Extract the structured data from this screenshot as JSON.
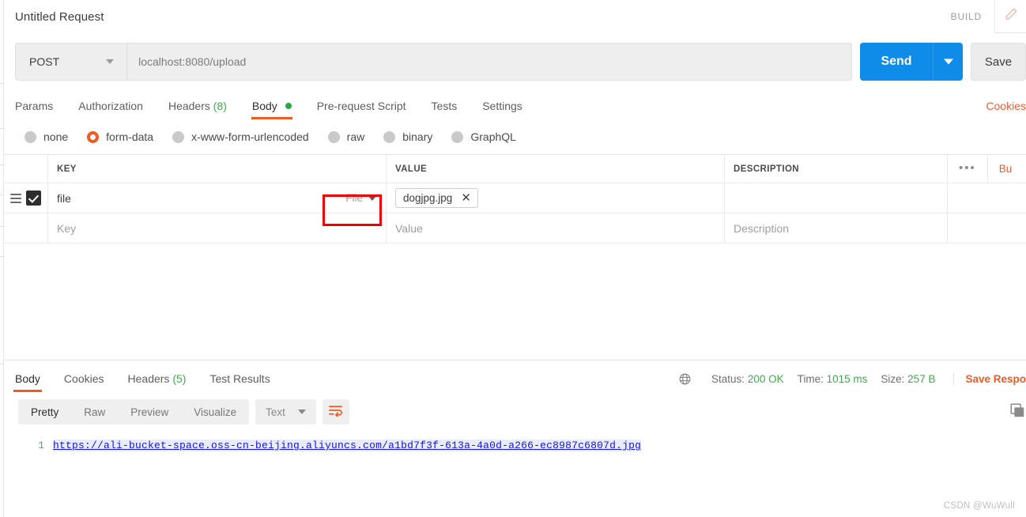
{
  "titlebar": {
    "request_title": "Untitled Request",
    "build_label": "BUILD",
    "edit_icon": "pencil-icon"
  },
  "urlbar": {
    "method": "POST",
    "url": "localhost:8080/upload",
    "send_label": "Send",
    "save_label": "Save"
  },
  "request_tabs": {
    "items": [
      {
        "label": "Params",
        "count": "",
        "active": false
      },
      {
        "label": "Authorization",
        "count": "",
        "active": false
      },
      {
        "label": "Headers",
        "count": "(8)",
        "active": false
      },
      {
        "label": "Body",
        "count": "",
        "active": true
      },
      {
        "label": "Pre-request Script",
        "count": "",
        "active": false
      },
      {
        "label": "Tests",
        "count": "",
        "active": false
      },
      {
        "label": "Settings",
        "count": "",
        "active": false
      }
    ],
    "cookies_link": "Cookies"
  },
  "body_types": {
    "options": [
      {
        "label": "none",
        "selected": false
      },
      {
        "label": "form-data",
        "selected": true
      },
      {
        "label": "x-www-form-urlencoded",
        "selected": false
      },
      {
        "label": "raw",
        "selected": false
      },
      {
        "label": "binary",
        "selected": false
      },
      {
        "label": "GraphQL",
        "selected": false
      }
    ]
  },
  "params_table": {
    "headers": {
      "key": "KEY",
      "value": "VALUE",
      "description": "DESCRIPTION",
      "more": "•••",
      "bulk_edit": "Bu"
    },
    "row": {
      "key": "file",
      "type": "File",
      "file_name": "dogjpg.jpg",
      "remove_glyph": "✕",
      "checked": true
    },
    "placeholders": {
      "key": "Key",
      "value": "Value",
      "description": "Description"
    }
  },
  "response": {
    "tabs": [
      {
        "label": "Body",
        "count": "",
        "active": true
      },
      {
        "label": "Cookies",
        "count": "",
        "active": false
      },
      {
        "label": "Headers",
        "count": "(5)",
        "active": false
      },
      {
        "label": "Test Results",
        "count": "",
        "active": false
      }
    ],
    "meta": {
      "status_label": "Status:",
      "status_value": "200 OK",
      "time_label": "Time:",
      "time_value": "1015 ms",
      "size_label": "Size:",
      "size_value": "257 B",
      "save_response": "Save Respo"
    },
    "view_modes": [
      {
        "label": "Pretty",
        "active": true
      },
      {
        "label": "Raw",
        "active": false
      },
      {
        "label": "Preview",
        "active": false
      },
      {
        "label": "Visualize",
        "active": false
      }
    ],
    "language": "Text",
    "body": {
      "line_number": "1",
      "content": "https://ali-bucket-space.oss-cn-beijing.aliyuncs.com/a1bd7f3f-613a-4a0d-a266-ec8987c6807d.jpg"
    }
  },
  "watermark": "CSDN @WuWull",
  "colors": {
    "accent_orange": "#ef5b25",
    "send_blue": "#0f8ce8",
    "status_green": "#3dab4c",
    "highlight_red": "#ee0000",
    "link_blue": "#1414dd"
  }
}
